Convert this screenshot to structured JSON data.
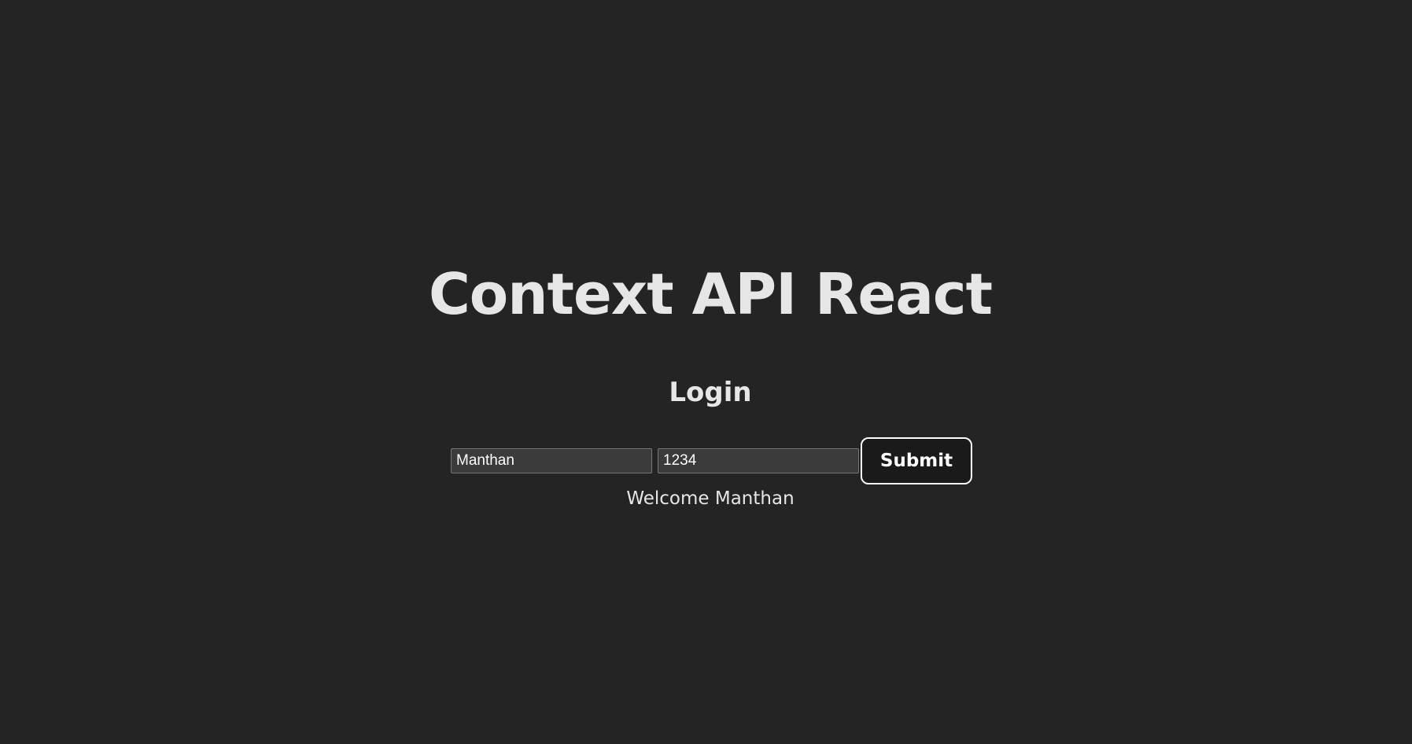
{
  "app": {
    "title": "Context API React"
  },
  "login": {
    "heading": "Login",
    "username_value": "Manthan",
    "password_value": "1234",
    "submit_label": "Submit"
  },
  "profile": {
    "welcome_text": "Welcome Manthan"
  },
  "colors": {
    "background": "#242424",
    "text": "#e6e6e6",
    "input_background": "#3b3b3b",
    "button_background": "#1a1a1a",
    "button_border": "#ffffff"
  }
}
